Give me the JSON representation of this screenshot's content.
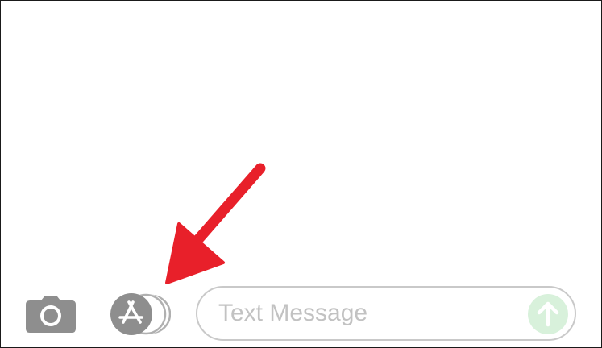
{
  "composer": {
    "placeholder": "Text Message"
  },
  "icons": {
    "camera": "camera-icon",
    "apps": "app-store-icon",
    "send": "arrow-up-icon",
    "annotation": "red-arrow-icon"
  },
  "colors": {
    "icon_gray": "#8e8e8e",
    "send_green": "#d8f1db",
    "send_arrow": "#ffffff",
    "annotation_red": "#e8202a",
    "field_border": "#c9c9c9",
    "placeholder": "#c2c2c2"
  }
}
